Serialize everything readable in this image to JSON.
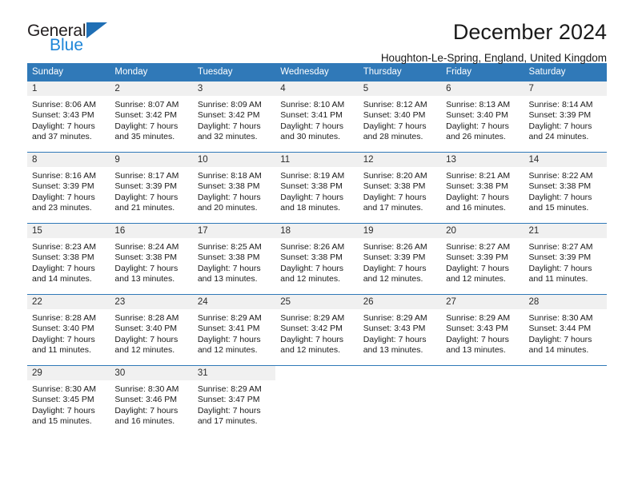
{
  "brand": {
    "name_top": "General",
    "name_bottom": "Blue",
    "mark": "triangle-logo"
  },
  "header": {
    "title": "December 2024",
    "subtitle": "Houghton-Le-Spring, England, United Kingdom"
  },
  "calendar": {
    "weekday_headers": [
      "Sunday",
      "Monday",
      "Tuesday",
      "Wednesday",
      "Thursday",
      "Friday",
      "Saturday"
    ],
    "accent_color": "#3079b8",
    "daynum_bg": "#f0f0f0",
    "weeks": [
      [
        {
          "day": "1",
          "sunrise": "Sunrise: 8:06 AM",
          "sunset": "Sunset: 3:43 PM",
          "daylight_line1": "Daylight: 7 hours",
          "daylight_line2": "and 37 minutes."
        },
        {
          "day": "2",
          "sunrise": "Sunrise: 8:07 AM",
          "sunset": "Sunset: 3:42 PM",
          "daylight_line1": "Daylight: 7 hours",
          "daylight_line2": "and 35 minutes."
        },
        {
          "day": "3",
          "sunrise": "Sunrise: 8:09 AM",
          "sunset": "Sunset: 3:42 PM",
          "daylight_line1": "Daylight: 7 hours",
          "daylight_line2": "and 32 minutes."
        },
        {
          "day": "4",
          "sunrise": "Sunrise: 8:10 AM",
          "sunset": "Sunset: 3:41 PM",
          "daylight_line1": "Daylight: 7 hours",
          "daylight_line2": "and 30 minutes."
        },
        {
          "day": "5",
          "sunrise": "Sunrise: 8:12 AM",
          "sunset": "Sunset: 3:40 PM",
          "daylight_line1": "Daylight: 7 hours",
          "daylight_line2": "and 28 minutes."
        },
        {
          "day": "6",
          "sunrise": "Sunrise: 8:13 AM",
          "sunset": "Sunset: 3:40 PM",
          "daylight_line1": "Daylight: 7 hours",
          "daylight_line2": "and 26 minutes."
        },
        {
          "day": "7",
          "sunrise": "Sunrise: 8:14 AM",
          "sunset": "Sunset: 3:39 PM",
          "daylight_line1": "Daylight: 7 hours",
          "daylight_line2": "and 24 minutes."
        }
      ],
      [
        {
          "day": "8",
          "sunrise": "Sunrise: 8:16 AM",
          "sunset": "Sunset: 3:39 PM",
          "daylight_line1": "Daylight: 7 hours",
          "daylight_line2": "and 23 minutes."
        },
        {
          "day": "9",
          "sunrise": "Sunrise: 8:17 AM",
          "sunset": "Sunset: 3:39 PM",
          "daylight_line1": "Daylight: 7 hours",
          "daylight_line2": "and 21 minutes."
        },
        {
          "day": "10",
          "sunrise": "Sunrise: 8:18 AM",
          "sunset": "Sunset: 3:38 PM",
          "daylight_line1": "Daylight: 7 hours",
          "daylight_line2": "and 20 minutes."
        },
        {
          "day": "11",
          "sunrise": "Sunrise: 8:19 AM",
          "sunset": "Sunset: 3:38 PM",
          "daylight_line1": "Daylight: 7 hours",
          "daylight_line2": "and 18 minutes."
        },
        {
          "day": "12",
          "sunrise": "Sunrise: 8:20 AM",
          "sunset": "Sunset: 3:38 PM",
          "daylight_line1": "Daylight: 7 hours",
          "daylight_line2": "and 17 minutes."
        },
        {
          "day": "13",
          "sunrise": "Sunrise: 8:21 AM",
          "sunset": "Sunset: 3:38 PM",
          "daylight_line1": "Daylight: 7 hours",
          "daylight_line2": "and 16 minutes."
        },
        {
          "day": "14",
          "sunrise": "Sunrise: 8:22 AM",
          "sunset": "Sunset: 3:38 PM",
          "daylight_line1": "Daylight: 7 hours",
          "daylight_line2": "and 15 minutes."
        }
      ],
      [
        {
          "day": "15",
          "sunrise": "Sunrise: 8:23 AM",
          "sunset": "Sunset: 3:38 PM",
          "daylight_line1": "Daylight: 7 hours",
          "daylight_line2": "and 14 minutes."
        },
        {
          "day": "16",
          "sunrise": "Sunrise: 8:24 AM",
          "sunset": "Sunset: 3:38 PM",
          "daylight_line1": "Daylight: 7 hours",
          "daylight_line2": "and 13 minutes."
        },
        {
          "day": "17",
          "sunrise": "Sunrise: 8:25 AM",
          "sunset": "Sunset: 3:38 PM",
          "daylight_line1": "Daylight: 7 hours",
          "daylight_line2": "and 13 minutes."
        },
        {
          "day": "18",
          "sunrise": "Sunrise: 8:26 AM",
          "sunset": "Sunset: 3:38 PM",
          "daylight_line1": "Daylight: 7 hours",
          "daylight_line2": "and 12 minutes."
        },
        {
          "day": "19",
          "sunrise": "Sunrise: 8:26 AM",
          "sunset": "Sunset: 3:39 PM",
          "daylight_line1": "Daylight: 7 hours",
          "daylight_line2": "and 12 minutes."
        },
        {
          "day": "20",
          "sunrise": "Sunrise: 8:27 AM",
          "sunset": "Sunset: 3:39 PM",
          "daylight_line1": "Daylight: 7 hours",
          "daylight_line2": "and 12 minutes."
        },
        {
          "day": "21",
          "sunrise": "Sunrise: 8:27 AM",
          "sunset": "Sunset: 3:39 PM",
          "daylight_line1": "Daylight: 7 hours",
          "daylight_line2": "and 11 minutes."
        }
      ],
      [
        {
          "day": "22",
          "sunrise": "Sunrise: 8:28 AM",
          "sunset": "Sunset: 3:40 PM",
          "daylight_line1": "Daylight: 7 hours",
          "daylight_line2": "and 11 minutes."
        },
        {
          "day": "23",
          "sunrise": "Sunrise: 8:28 AM",
          "sunset": "Sunset: 3:40 PM",
          "daylight_line1": "Daylight: 7 hours",
          "daylight_line2": "and 12 minutes."
        },
        {
          "day": "24",
          "sunrise": "Sunrise: 8:29 AM",
          "sunset": "Sunset: 3:41 PM",
          "daylight_line1": "Daylight: 7 hours",
          "daylight_line2": "and 12 minutes."
        },
        {
          "day": "25",
          "sunrise": "Sunrise: 8:29 AM",
          "sunset": "Sunset: 3:42 PM",
          "daylight_line1": "Daylight: 7 hours",
          "daylight_line2": "and 12 minutes."
        },
        {
          "day": "26",
          "sunrise": "Sunrise: 8:29 AM",
          "sunset": "Sunset: 3:43 PM",
          "daylight_line1": "Daylight: 7 hours",
          "daylight_line2": "and 13 minutes."
        },
        {
          "day": "27",
          "sunrise": "Sunrise: 8:29 AM",
          "sunset": "Sunset: 3:43 PM",
          "daylight_line1": "Daylight: 7 hours",
          "daylight_line2": "and 13 minutes."
        },
        {
          "day": "28",
          "sunrise": "Sunrise: 8:30 AM",
          "sunset": "Sunset: 3:44 PM",
          "daylight_line1": "Daylight: 7 hours",
          "daylight_line2": "and 14 minutes."
        }
      ],
      [
        {
          "day": "29",
          "sunrise": "Sunrise: 8:30 AM",
          "sunset": "Sunset: 3:45 PM",
          "daylight_line1": "Daylight: 7 hours",
          "daylight_line2": "and 15 minutes."
        },
        {
          "day": "30",
          "sunrise": "Sunrise: 8:30 AM",
          "sunset": "Sunset: 3:46 PM",
          "daylight_line1": "Daylight: 7 hours",
          "daylight_line2": "and 16 minutes."
        },
        {
          "day": "31",
          "sunrise": "Sunrise: 8:29 AM",
          "sunset": "Sunset: 3:47 PM",
          "daylight_line1": "Daylight: 7 hours",
          "daylight_line2": "and 17 minutes."
        },
        {
          "day": "",
          "sunrise": "",
          "sunset": "",
          "daylight_line1": "",
          "daylight_line2": ""
        },
        {
          "day": "",
          "sunrise": "",
          "sunset": "",
          "daylight_line1": "",
          "daylight_line2": ""
        },
        {
          "day": "",
          "sunrise": "",
          "sunset": "",
          "daylight_line1": "",
          "daylight_line2": ""
        },
        {
          "day": "",
          "sunrise": "",
          "sunset": "",
          "daylight_line1": "",
          "daylight_line2": ""
        }
      ]
    ]
  }
}
